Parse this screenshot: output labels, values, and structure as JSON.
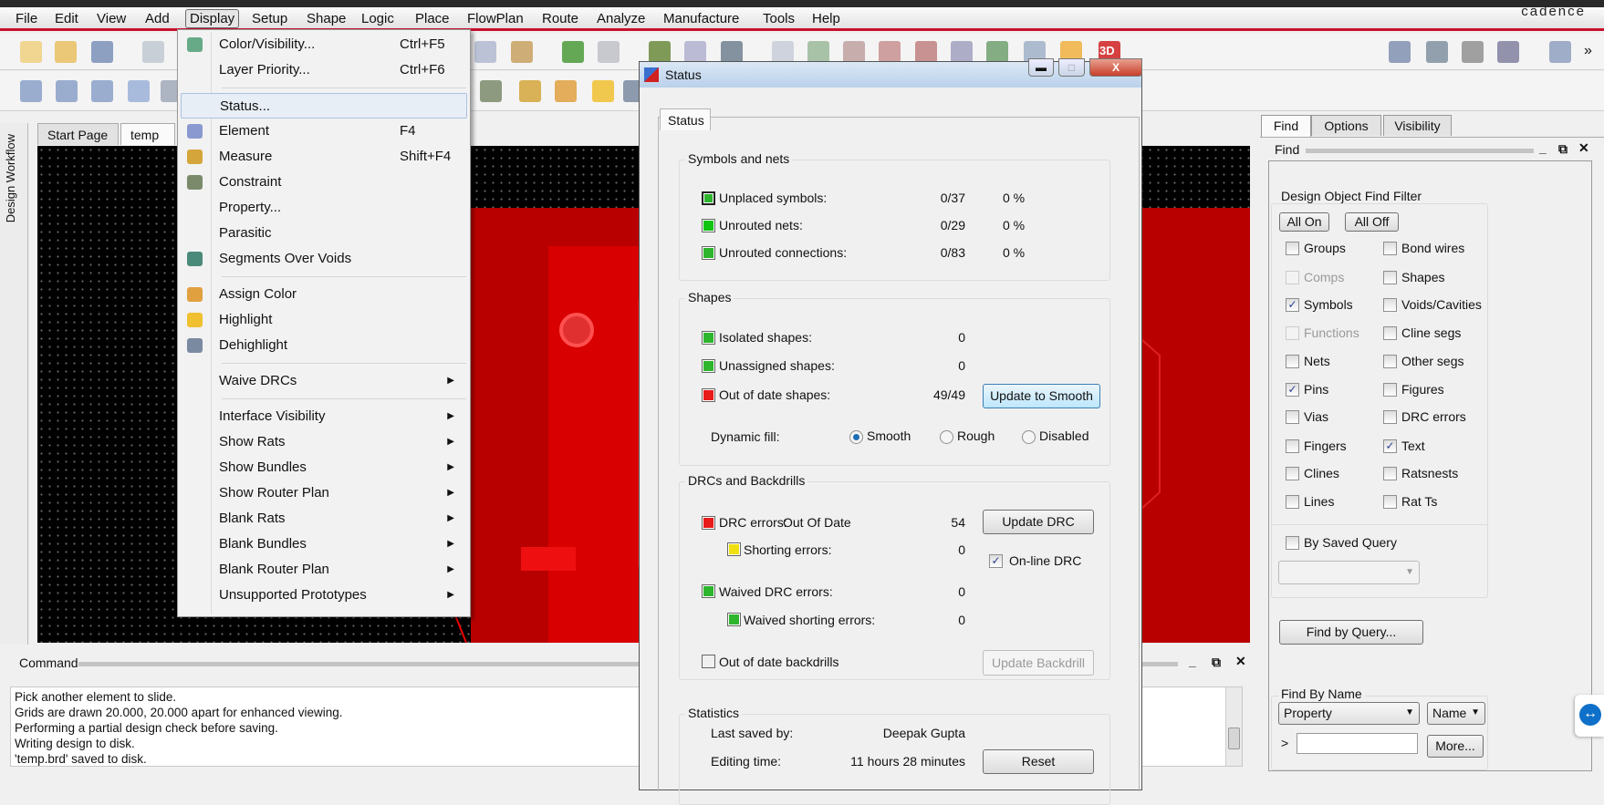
{
  "menubar": {
    "items": [
      "File",
      "Edit",
      "View",
      "Add",
      "Display",
      "Setup",
      "Shape",
      "Logic",
      "Place",
      "FlowPlan",
      "Route",
      "Analyze",
      "Manufacture",
      "Tools",
      "Help"
    ],
    "active": "Display",
    "brand": "cādence"
  },
  "toolbar": {
    "row1_icons": [
      "new-file-icon",
      "open-folder-icon",
      "save-icon",
      "move-icon",
      "add-text-icon",
      "edit-text-icon",
      "place-component-icon",
      "component-u1-icon",
      "add-connect-icon",
      "slide-icon",
      "delay-tune-icon",
      "grid-view-icon",
      "grid-icon",
      "zoom-points-icon",
      "zoom-window-icon",
      "zoom-in-icon",
      "zoom-out-icon",
      "zoom-fit-icon",
      "zoom-world-icon",
      "redraw-icon",
      "3d-view-icon",
      "constraint-manager-icon",
      "tools-icon",
      "camera-icon",
      "refdes-icon",
      "windows-icon"
    ],
    "row2_icons": [
      "shape-add-icon",
      "rectangle-icon",
      "circle-icon",
      "select-icon",
      "dimension-icon",
      "constraint-icon",
      "measure-icon",
      "assign-color-icon",
      "highlight-icon",
      "dehighlight-icon"
    ],
    "overflow": "»",
    "three_d": "3D"
  },
  "left_strip": {
    "label": "Design Workflow"
  },
  "doc_tabs": [
    {
      "label": "Start Page"
    },
    {
      "label": "temp"
    }
  ],
  "display_menu": {
    "items": [
      {
        "label": "Color/Visibility...",
        "shortcut": "Ctrl+F5",
        "icon": "color-visibility-icon",
        "color": "#6a8"
      },
      {
        "label": "Layer Priority...",
        "shortcut": "Ctrl+F6"
      },
      {
        "sep": true
      },
      {
        "label": "Status...",
        "highlighted": true
      },
      {
        "label": "Element",
        "shortcut": "F4",
        "icon": "info-icon",
        "color": "#8a9ad0"
      },
      {
        "label": "Measure",
        "shortcut": "Shift+F4",
        "icon": "ruler-icon",
        "color": "#d4a53a"
      },
      {
        "label": "Constraint",
        "icon": "constraint-icon",
        "color": "#7a8a6a"
      },
      {
        "label": "Property..."
      },
      {
        "label": "Parasitic"
      },
      {
        "label": "Segments Over Voids",
        "icon": "segments-icon",
        "color": "#4a8a7a"
      },
      {
        "sep": true
      },
      {
        "label": "Assign Color",
        "icon": "brush-icon",
        "color": "#e0a040"
      },
      {
        "label": "Highlight",
        "icon": "sun-icon",
        "color": "#f0c030"
      },
      {
        "label": "Dehighlight",
        "icon": "dehighlight-icon",
        "color": "#7a8aa0"
      },
      {
        "sep": true
      },
      {
        "label": "Waive DRCs",
        "submenu": true
      },
      {
        "sep": true
      },
      {
        "label": "Interface Visibility",
        "submenu": true
      },
      {
        "label": "Show Rats",
        "submenu": true
      },
      {
        "label": "Show Bundles",
        "submenu": true
      },
      {
        "label": "Show Router Plan",
        "submenu": true
      },
      {
        "label": "Blank Rats",
        "submenu": true
      },
      {
        "label": "Blank Bundles",
        "submenu": true
      },
      {
        "label": "Blank Router Plan",
        "submenu": true
      },
      {
        "label": "Unsupported Prototypes",
        "submenu": true
      }
    ]
  },
  "status_dialog": {
    "title": "Status",
    "tab": "Status",
    "symbols": {
      "title": "Symbols and nets",
      "rows": [
        {
          "label": "Unplaced symbols:",
          "value": "0/37",
          "pct": "0 %",
          "color": "#2db52d"
        },
        {
          "label": "Unrouted nets:",
          "value": "0/29",
          "pct": "0 %",
          "color": "#11c411"
        },
        {
          "label": "Unrouted connections:",
          "value": "0/83",
          "pct": "0 %",
          "color": "#2db52d"
        }
      ]
    },
    "shapes": {
      "title": "Shapes",
      "rows": [
        {
          "label": "Isolated shapes:",
          "value": "0",
          "color": "#2db52d"
        },
        {
          "label": "Unassigned shapes:",
          "value": "0",
          "color": "#2db52d"
        },
        {
          "label": "Out of date shapes:",
          "value": "49/49",
          "color": "#e81a1a"
        }
      ],
      "update_button": "Update to Smooth",
      "dynamic_fill_label": "Dynamic fill:",
      "fill_options": [
        "Smooth",
        "Rough",
        "Disabled"
      ],
      "fill_selected": "Smooth"
    },
    "drc": {
      "title": "DRCs and Backdrills",
      "drc_errors_label": "DRC errors:",
      "drc_errors_state": "Out Of Date",
      "drc_errors_value": "54",
      "drc_color": "#e81a1a",
      "shorting_label": "Shorting errors:",
      "shorting_value": "0",
      "shorting_color": "#f0e010",
      "waived_label": "Waived DRC errors:",
      "waived_value": "0",
      "waived_shorting_label": "Waived shorting errors:",
      "waived_shorting_value": "0",
      "ok_color": "#2db52d",
      "backdrills_label": "Out of date backdrills",
      "update_drc": "Update DRC",
      "online_drc": "On-line DRC",
      "online_drc_checked": true,
      "update_backdrill": "Update Backdrill"
    },
    "statistics": {
      "title": "Statistics",
      "last_saved_label": "Last saved by:",
      "last_saved_value": "Deepak Gupta",
      "editing_label": "Editing time:",
      "editing_value": "11 hours 28 minutes",
      "reset": "Reset"
    }
  },
  "right_panel": {
    "tabs": [
      "Find",
      "Options",
      "Visibility"
    ],
    "active_tab": "Find",
    "header": "Find",
    "filter_title": "Design Object Find Filter",
    "all_on": "All On",
    "all_off": "All Off",
    "col1": [
      {
        "label": "Groups",
        "checked": false
      },
      {
        "label": "Comps",
        "checked": false,
        "disabled": true
      },
      {
        "label": "Symbols",
        "checked": true
      },
      {
        "label": "Functions",
        "checked": false,
        "disabled": true
      },
      {
        "label": "Nets",
        "checked": false
      },
      {
        "label": "Pins",
        "checked": true
      },
      {
        "label": "Vias",
        "checked": false
      },
      {
        "label": "Fingers",
        "checked": false
      },
      {
        "label": "Clines",
        "checked": false
      },
      {
        "label": "Lines",
        "checked": false
      }
    ],
    "col2": [
      {
        "label": "Bond wires",
        "checked": false
      },
      {
        "label": "Shapes",
        "checked": false
      },
      {
        "label": "Voids/Cavities",
        "checked": false
      },
      {
        "label": "Cline segs",
        "checked": false
      },
      {
        "label": "Other segs",
        "checked": false
      },
      {
        "label": "Figures",
        "checked": false
      },
      {
        "label": "DRC errors",
        "checked": false
      },
      {
        "label": "Text",
        "checked": true
      },
      {
        "label": "Ratsnests",
        "checked": false
      },
      {
        "label": "Rat Ts",
        "checked": false
      }
    ],
    "by_saved_query": "By Saved Query",
    "saved_query_value": "",
    "find_by_query": "Find by Query...",
    "find_by_name_title": "Find By Name",
    "property_select": "Property",
    "name_select": "Name",
    "prompt": ">",
    "name_input_value": "",
    "more": "More..."
  },
  "command": {
    "title": "Command",
    "lines": [
      "Pick another element to slide.",
      "Grids are drawn 20.000, 20.000 apart for enhanced viewing.",
      "Performing a partial design check before saving.",
      "Writing design to disk.",
      "'temp.brd' saved to disk."
    ]
  }
}
